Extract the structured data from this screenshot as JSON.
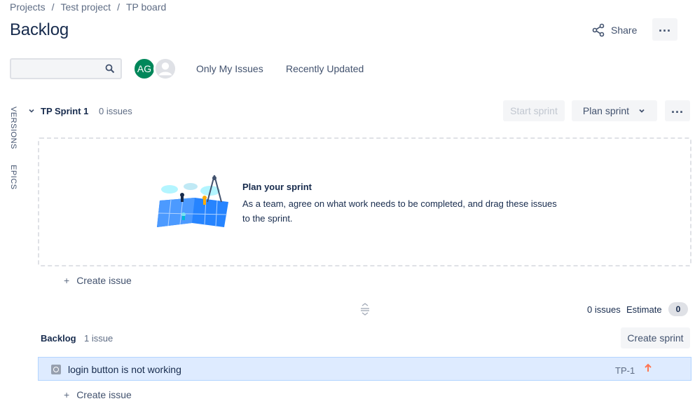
{
  "breadcrumb": [
    "Projects",
    "Test project",
    "TP board"
  ],
  "page_title": "Backlog",
  "header": {
    "share_label": "Share",
    "more_icon": "more-icon"
  },
  "toolbar": {
    "search_value": "",
    "search_placeholder": "",
    "avatar_initials": "AG",
    "filters": [
      "Only My Issues",
      "Recently Updated"
    ]
  },
  "side_tabs": [
    "VERSIONS",
    "EPICS"
  ],
  "sprint": {
    "name": "TP Sprint 1",
    "count": "0 issues",
    "start_label": "Start sprint",
    "plan_label": "Plan sprint",
    "empty_title": "Plan your sprint",
    "empty_desc": "As a team, agree on what work needs to be completed, and drag these issues to the sprint.",
    "create_issue": "Create issue"
  },
  "summary": {
    "issues": "0 issues",
    "estimate_label": "Estimate",
    "estimate_value": "0"
  },
  "backlog": {
    "title": "Backlog",
    "count": "1 issue",
    "create_sprint_label": "Create sprint",
    "create_issue": "Create issue",
    "issues": [
      {
        "summary": "login button is not working",
        "key": "TP-1",
        "priority": "high"
      }
    ]
  },
  "colors": {
    "accent": "#0052cc",
    "avatar_bg": "#00875a",
    "row_selected": "#deebff",
    "priority_high": "#ff7452"
  }
}
